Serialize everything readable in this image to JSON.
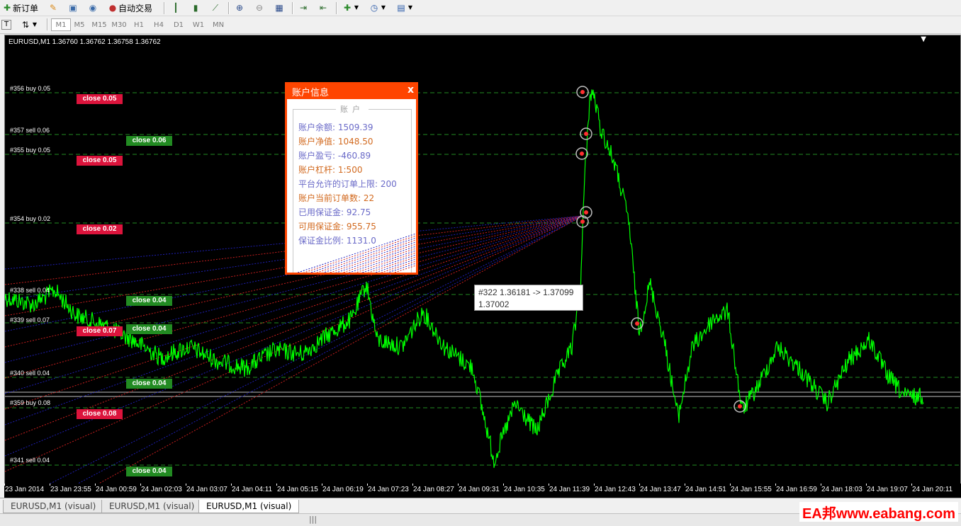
{
  "toolbar": {
    "new_order": "新订单",
    "auto_trade": "自动交易",
    "timeframes": [
      "M1",
      "M5",
      "M15",
      "M30",
      "H1",
      "H4",
      "D1",
      "W1",
      "MN"
    ],
    "selected_timeframe": "M1"
  },
  "chart": {
    "symbol_line": "EURUSD,M1  1.36760 1.36762 1.36758 1.36762",
    "background": "#000000",
    "price_color": "#00ff00",
    "grid_line_color": "#228b22",
    "order_labels": [
      {
        "text": "#356 buy 0.05"
      },
      {
        "text": "#357 sell 0.06"
      },
      {
        "text": "#355 buy 0.05"
      },
      {
        "text": "#354 buy 0.02"
      },
      {
        "text": "#338 sell 0.04"
      },
      {
        "text": "#339 sell 0.07"
      },
      {
        "text": "#340 sell 0.04"
      },
      {
        "text": "#359 buy 0.08"
      },
      {
        "text": "#341 sell 0.04"
      }
    ],
    "close_buttons": [
      {
        "text": "close 0.05",
        "color": "red"
      },
      {
        "text": "close 0.06",
        "color": "green"
      },
      {
        "text": "close 0.05",
        "color": "red"
      },
      {
        "text": "close 0.02",
        "color": "red"
      },
      {
        "text": "close 0.04",
        "color": "green"
      },
      {
        "text": "close 0.07",
        "color": "red"
      },
      {
        "text": "close 0.04",
        "color": "green"
      },
      {
        "text": "close 0.04",
        "color": "green"
      },
      {
        "text": "close 0.08",
        "color": "red"
      },
      {
        "text": "close 0.04",
        "color": "green"
      }
    ],
    "x_ticks": [
      "23 Jan 2014",
      "23 Jan 23:55",
      "24 Jan 00:59",
      "24 Jan 02:03",
      "24 Jan 03:07",
      "24 Jan 04:11",
      "24 Jan 05:15",
      "24 Jan 06:19",
      "24 Jan 07:23",
      "24 Jan 08:27",
      "24 Jan 09:31",
      "24 Jan 10:35",
      "24 Jan 11:39",
      "24 Jan 12:43",
      "24 Jan 13:47",
      "24 Jan 14:51",
      "24 Jan 15:55",
      "24 Jan 16:59",
      "24 Jan 18:03",
      "24 Jan 19:07",
      "24 Jan 20:11"
    ]
  },
  "account_panel": {
    "title": "账户信息",
    "close": "x",
    "group_title": "账户",
    "rows": [
      {
        "label": "账户余额",
        "value": "1509.39",
        "color": "#6a6ac8"
      },
      {
        "label": "账户净值",
        "value": "1048.50",
        "color": "#d2691e"
      },
      {
        "label": "账户盈亏",
        "value": "-460.89",
        "color": "#6a6ac8"
      },
      {
        "label": "账户杠杆",
        "value": "1:500",
        "color": "#d2691e"
      },
      {
        "label": "平台允许的订单上限",
        "value": "200",
        "color": "#6a6ac8"
      },
      {
        "label": "账户当前订单数",
        "value": "22",
        "color": "#d2691e"
      },
      {
        "label": "已用保证金",
        "value": "92.75",
        "color": "#6a6ac8"
      },
      {
        "label": "可用保证金",
        "value": "955.75",
        "color": "#d2691e"
      },
      {
        "label": "保证金比例",
        "value": "1131.0",
        "color": "#6a6ac8"
      }
    ]
  },
  "tooltip": {
    "line1": "#322 1.36181 -> 1.37099",
    "line2": "1.37002"
  },
  "tabs": [
    "EURUSD,M1 (visual)",
    "EURUSD,M1 (visual)",
    "EURUSD,M1 (visual)"
  ],
  "status": {
    "grip": "|||"
  },
  "watermark": "EA邦www.eabang.com"
}
